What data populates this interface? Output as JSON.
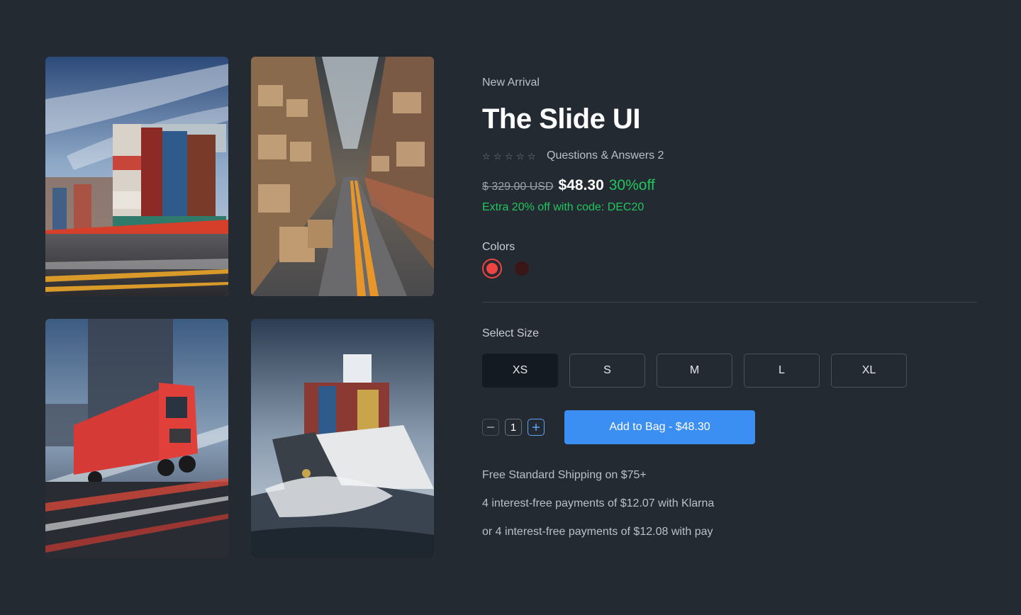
{
  "gallery": {
    "images": [
      {
        "icon": "container-ship-road-photo"
      },
      {
        "icon": "warehouse-photo"
      },
      {
        "icon": "red-truck-photo"
      },
      {
        "icon": "cargo-ship-sea-photo"
      }
    ]
  },
  "product": {
    "eyebrow": "New Arrival",
    "title": "The Slide UI",
    "qa_label": "Questions & Answers 2",
    "rating_stars": 0,
    "old_price": "$ 329.00 USD",
    "price": "$48.30",
    "discount": "30%off",
    "promo": "Extra 20% off with code: DEC20"
  },
  "colors": {
    "label": "Colors",
    "options": [
      "#ef4444",
      "#3a1716"
    ],
    "selected_index": 0
  },
  "size": {
    "label": "Select Size",
    "options": [
      "XS",
      "S",
      "M",
      "L",
      "XL"
    ],
    "selected": "XS"
  },
  "cart": {
    "quantity": "1",
    "add_label": "Add to Bag - $48.30"
  },
  "shipping": {
    "line1": "Free Standard Shipping on $75+",
    "line2": "4 interest-free payments of $12.07 with Klarna",
    "line3": "or 4 interest-free payments of $12.08 with pay"
  },
  "theme": {
    "background": "#232a31",
    "accent": "#3b8ef2",
    "success": "#22c55e"
  }
}
